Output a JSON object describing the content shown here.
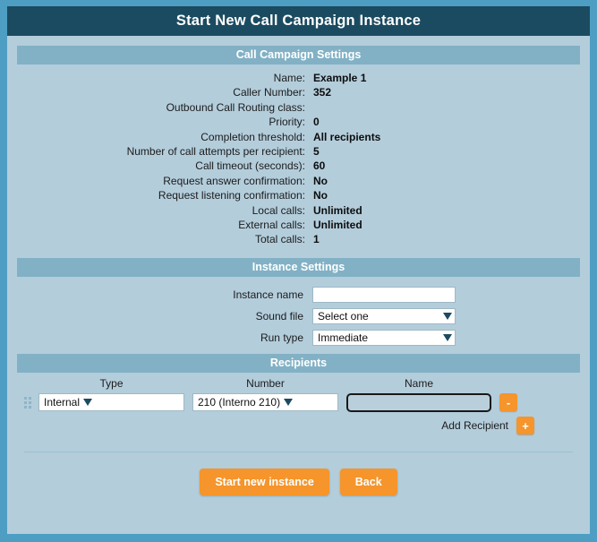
{
  "window": {
    "title": "Start New Call Campaign Instance"
  },
  "campaign_settings": {
    "heading": "Call Campaign Settings",
    "rows": [
      {
        "label": "Name:",
        "value": "Example 1"
      },
      {
        "label": "Caller Number:",
        "value": "352"
      },
      {
        "label": "Outbound Call Routing class:",
        "value": ""
      },
      {
        "label": "Priority:",
        "value": "0"
      },
      {
        "label": "Completion threshold:",
        "value": "All recipients"
      },
      {
        "label": "Number of call attempts per recipient:",
        "value": "5"
      },
      {
        "label": "Call timeout (seconds):",
        "value": "60"
      },
      {
        "label": "Request answer confirmation:",
        "value": "No"
      },
      {
        "label": "Request listening confirmation:",
        "value": "No"
      },
      {
        "label": "Local calls:",
        "value": "Unlimited"
      },
      {
        "label": "External calls:",
        "value": "Unlimited"
      },
      {
        "label": "Total calls:",
        "value": "1"
      }
    ]
  },
  "instance_settings": {
    "heading": "Instance Settings",
    "instance_name": {
      "label": "Instance name",
      "value": "",
      "placeholder": ""
    },
    "sound_file": {
      "label": "Sound file",
      "selected": "Select one"
    },
    "run_type": {
      "label": "Run type",
      "selected": "Immediate"
    }
  },
  "recipients": {
    "heading": "Recipients",
    "columns": {
      "type": "Type",
      "number": "Number",
      "name": "Name"
    },
    "rows": [
      {
        "type": "Internal",
        "number": "210 (Interno 210)",
        "name": "",
        "remove_label": "-"
      }
    ],
    "add_label": "Add Recipient",
    "add_symbol": "+"
  },
  "footer": {
    "submit_label": "Start new instance",
    "back_label": "Back"
  },
  "colors": {
    "titlebar": "#1b4b60",
    "panel": "#b3cddb",
    "section_header": "#82b1c5",
    "accent_orange": "#f5952b",
    "outer_border": "#4e9ec4"
  }
}
